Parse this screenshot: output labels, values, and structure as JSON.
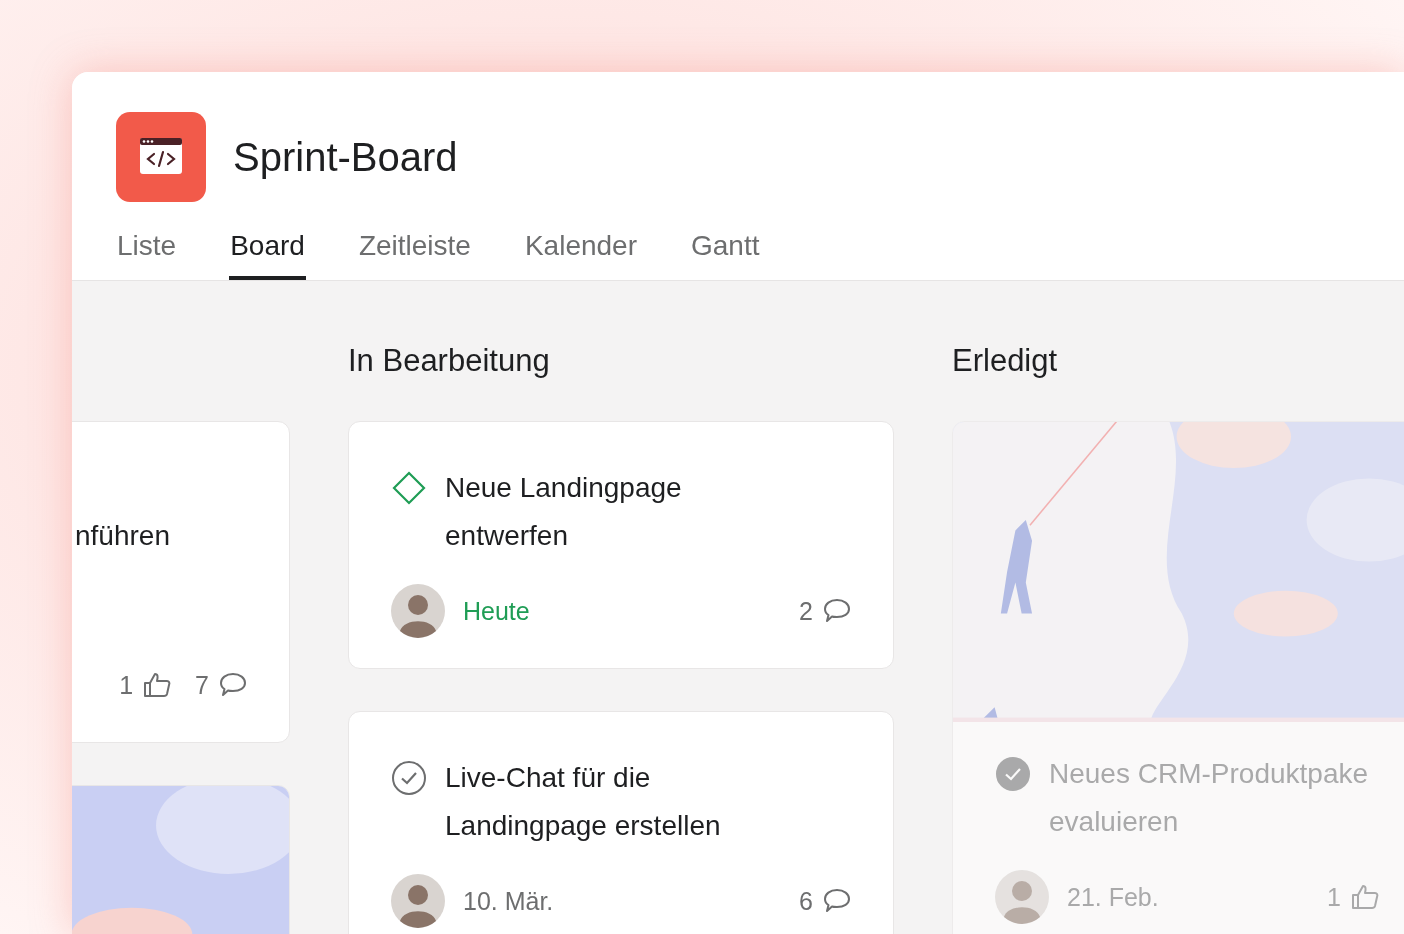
{
  "project": {
    "title": "Sprint-Board"
  },
  "tabs": [
    {
      "label": "Liste",
      "selected": false
    },
    {
      "label": "Board",
      "selected": true
    },
    {
      "label": "Zeitleiste",
      "selected": false
    },
    {
      "label": "Kalender",
      "selected": false
    },
    {
      "label": "Gantt",
      "selected": false
    }
  ],
  "columns": [
    {
      "cards": [
        {
          "title": "nführen",
          "likes": "1",
          "comments": "7"
        },
        {
          "cover": {
            "kind": "picture"
          }
        }
      ]
    },
    {
      "title": "In Bearbeitung",
      "cards": [
        {
          "kind": "milestone",
          "completed": false,
          "title": "Neue Landingpage entwerfen",
          "due": "Heute",
          "due_today": true,
          "comments": "2"
        },
        {
          "kind": "task",
          "completed": false,
          "title": "Live-Chat für die Landingpage erstellen",
          "due": "10. Mär.",
          "due_today": false,
          "comments": "6"
        }
      ]
    },
    {
      "title": "Erledigt",
      "cards": [
        {
          "cover": {
            "kind": "picture"
          },
          "kind": "task",
          "completed": true,
          "title": "Neues CRM-Produktpake evaluieren",
          "due": "21. Feb.",
          "due_today": false,
          "likes": "1"
        }
      ]
    }
  ]
}
